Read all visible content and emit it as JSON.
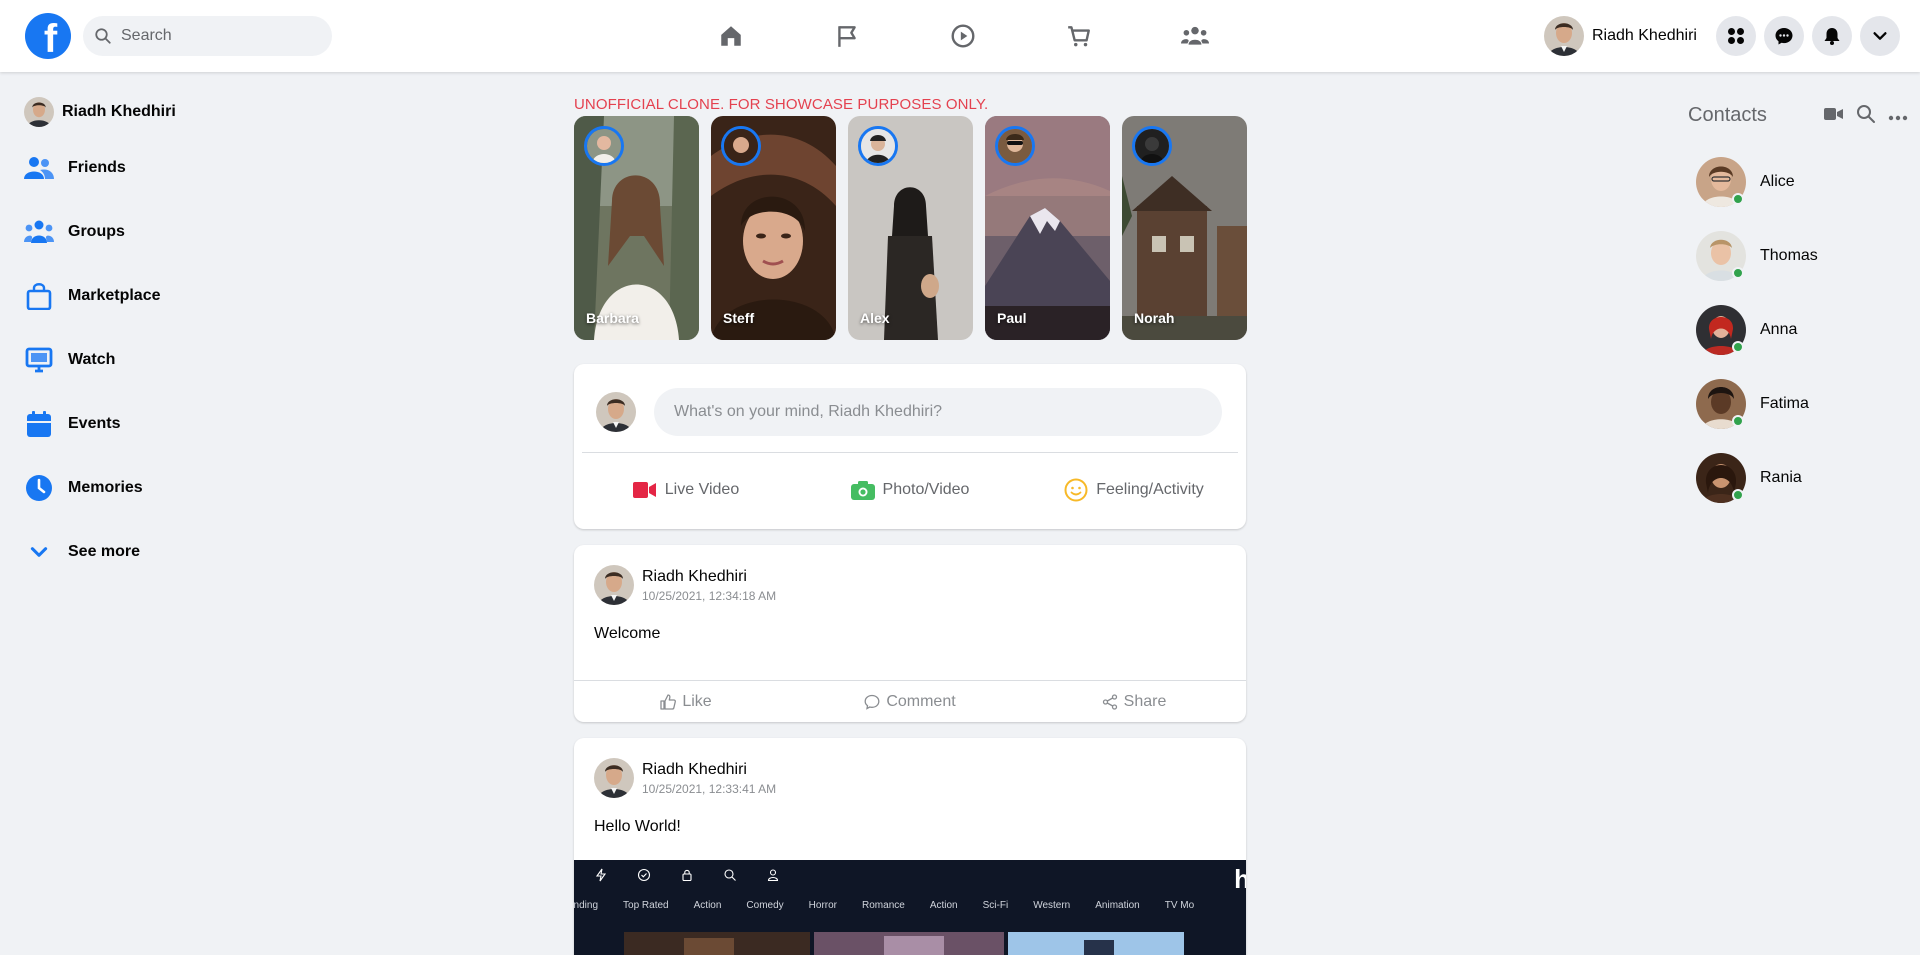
{
  "topbar": {
    "logo_letter": "f",
    "search": {
      "placeholder": "Search"
    },
    "nav": [
      "home-icon",
      "flag-icon",
      "watch-icon",
      "marketplace-icon",
      "groups-icon"
    ],
    "user_name": "Riadh Khedhiri",
    "buttons": [
      "menu-grid-icon",
      "messenger-icon",
      "bell-icon",
      "chevron-down-icon"
    ],
    "accent_color": "#1877f2"
  },
  "sidebar": {
    "user_name": "Riadh Khedhiri",
    "items": [
      {
        "label": "Friends",
        "icon": "friends-icon"
      },
      {
        "label": "Groups",
        "icon": "groups-icon"
      },
      {
        "label": "Marketplace",
        "icon": "shopping-bag-icon"
      },
      {
        "label": "Watch",
        "icon": "monitor-icon"
      },
      {
        "label": "Events",
        "icon": "calendar-icon"
      },
      {
        "label": "Memories",
        "icon": "clock-icon"
      },
      {
        "label": "See more",
        "icon": "chevron-down-icon"
      }
    ]
  },
  "notice": "UNOFFICIAL CLONE. FOR SHOWCASE PURPOSES ONLY.",
  "stories": [
    {
      "name": "Barbara"
    },
    {
      "name": "Steff"
    },
    {
      "name": "Alex"
    },
    {
      "name": "Paul"
    },
    {
      "name": "Norah"
    }
  ],
  "composer": {
    "placeholder": "What's on your mind, Riadh Khedhiri?",
    "actions": [
      {
        "label": "Live Video",
        "icon": "video-camera-icon",
        "color": "#e42645"
      },
      {
        "label": "Photo/Video",
        "icon": "camera-icon",
        "color": "#45bd62"
      },
      {
        "label": "Feeling/Activity",
        "icon": "smiley-icon",
        "color": "#f7b928"
      }
    ]
  },
  "posts": [
    {
      "author": "Riadh Khedhiri",
      "time": "10/25/2021, 12:34:18 AM",
      "text": "Welcome"
    },
    {
      "author": "Riadh Khedhiri",
      "time": "10/25/2021, 12:33:41 AM",
      "text": "Hello World!"
    }
  ],
  "post_actions": {
    "like": "Like",
    "comment": "Comment",
    "share": "Share"
  },
  "embedded_screenshot": {
    "logo": "h",
    "genres": [
      "ending",
      "Top Rated",
      "Action",
      "Comedy",
      "Horror",
      "Romance",
      "Action",
      "Sci-Fi",
      "Western",
      "Animation",
      "TV Mo"
    ]
  },
  "contacts": {
    "title": "Contacts",
    "icons": [
      "video-call-icon",
      "search-icon",
      "more-icon"
    ],
    "people": [
      {
        "name": "Alice",
        "status": "online"
      },
      {
        "name": "Thomas",
        "status": "online"
      },
      {
        "name": "Anna",
        "status": "online"
      },
      {
        "name": "Fatima",
        "status": "online"
      },
      {
        "name": "Rania",
        "status": "online"
      }
    ]
  }
}
